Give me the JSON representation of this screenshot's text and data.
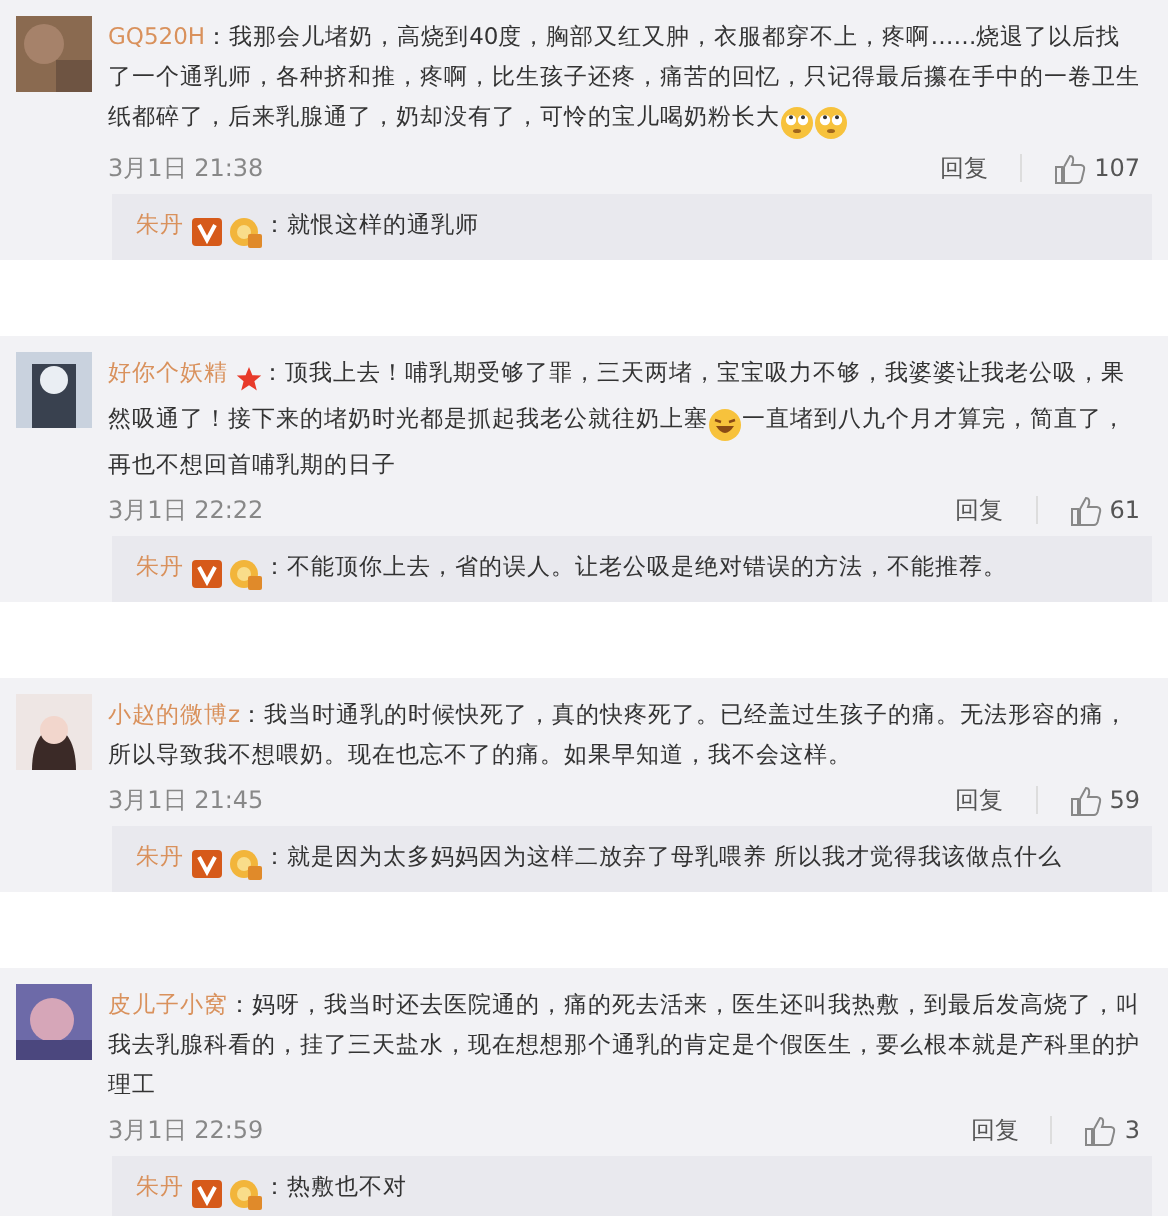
{
  "comments": [
    {
      "user": "GQ520H",
      "starred": false,
      "body": [
        {
          "kind": "text",
          "text": "：我那会儿堵奶，高烧到40度，胸部又红又肿，衣服都穿不上，疼啊……烧退了以后找了一个通乳师，各种挤和推，疼啊，比生孩子还疼，痛苦的回忆，只记得最后攥在手中的一卷卫生纸都碎了，后来乳腺通了，奶却没有了，可怜的宝儿喝奶粉长大"
        },
        {
          "kind": "emoji"
        },
        {
          "kind": "emoji"
        }
      ],
      "time": "3月1日 21:38",
      "reply_label": "回复",
      "likes": "107",
      "reply": {
        "user": "朱丹",
        "text": "：就恨这样的通乳师"
      }
    },
    {
      "user": "好你个妖精",
      "starred": true,
      "body": [
        {
          "kind": "text",
          "text": "：顶我上去！哺乳期受够了罪，三天两堵，宝宝吸力不够，我婆婆让我老公吸，果然吸通了！接下来的堵奶时光都是抓起我老公就往奶上塞"
        },
        {
          "kind": "laugh"
        },
        {
          "kind": "text",
          "text": "一直堵到八九个月才算完，简直了，再也不想回首哺乳期的日子"
        }
      ],
      "time": "3月1日 22:22",
      "reply_label": "回复",
      "likes": "61",
      "reply": {
        "user": "朱丹",
        "text": "：不能顶你上去，省的误人。让老公吸是绝对错误的方法，不能推荐。"
      }
    },
    {
      "user": "小赵的微博z",
      "starred": false,
      "body": [
        {
          "kind": "text",
          "text": "：我当时通乳的时候快死了，真的快疼死了。已经盖过生孩子的痛。无法形容的痛，所以导致我不想喂奶。现在也忘不了的痛。如果早知道，我不会这样。"
        }
      ],
      "time": "3月1日 21:45",
      "reply_label": "回复",
      "likes": "59",
      "reply": {
        "user": "朱丹",
        "text": "：就是因为太多妈妈因为这样二放弃了母乳喂养 所以我才觉得我该做点什么"
      }
    },
    {
      "user": "皮儿子小窝",
      "starred": false,
      "body": [
        {
          "kind": "text",
          "text": "：妈呀，我当时还去医院通的，痛的死去活来，医生还叫我热敷，到最后发高烧了，叫我去乳腺科看的，挂了三天盐水，现在想想那个通乳的肯定是个假医生，要么根本就是产科里的护理工"
        }
      ],
      "time": "3月1日 22:59",
      "reply_label": "回复",
      "likes": "3",
      "reply": {
        "user": "朱丹",
        "text": "：热敷也不对"
      }
    }
  ]
}
